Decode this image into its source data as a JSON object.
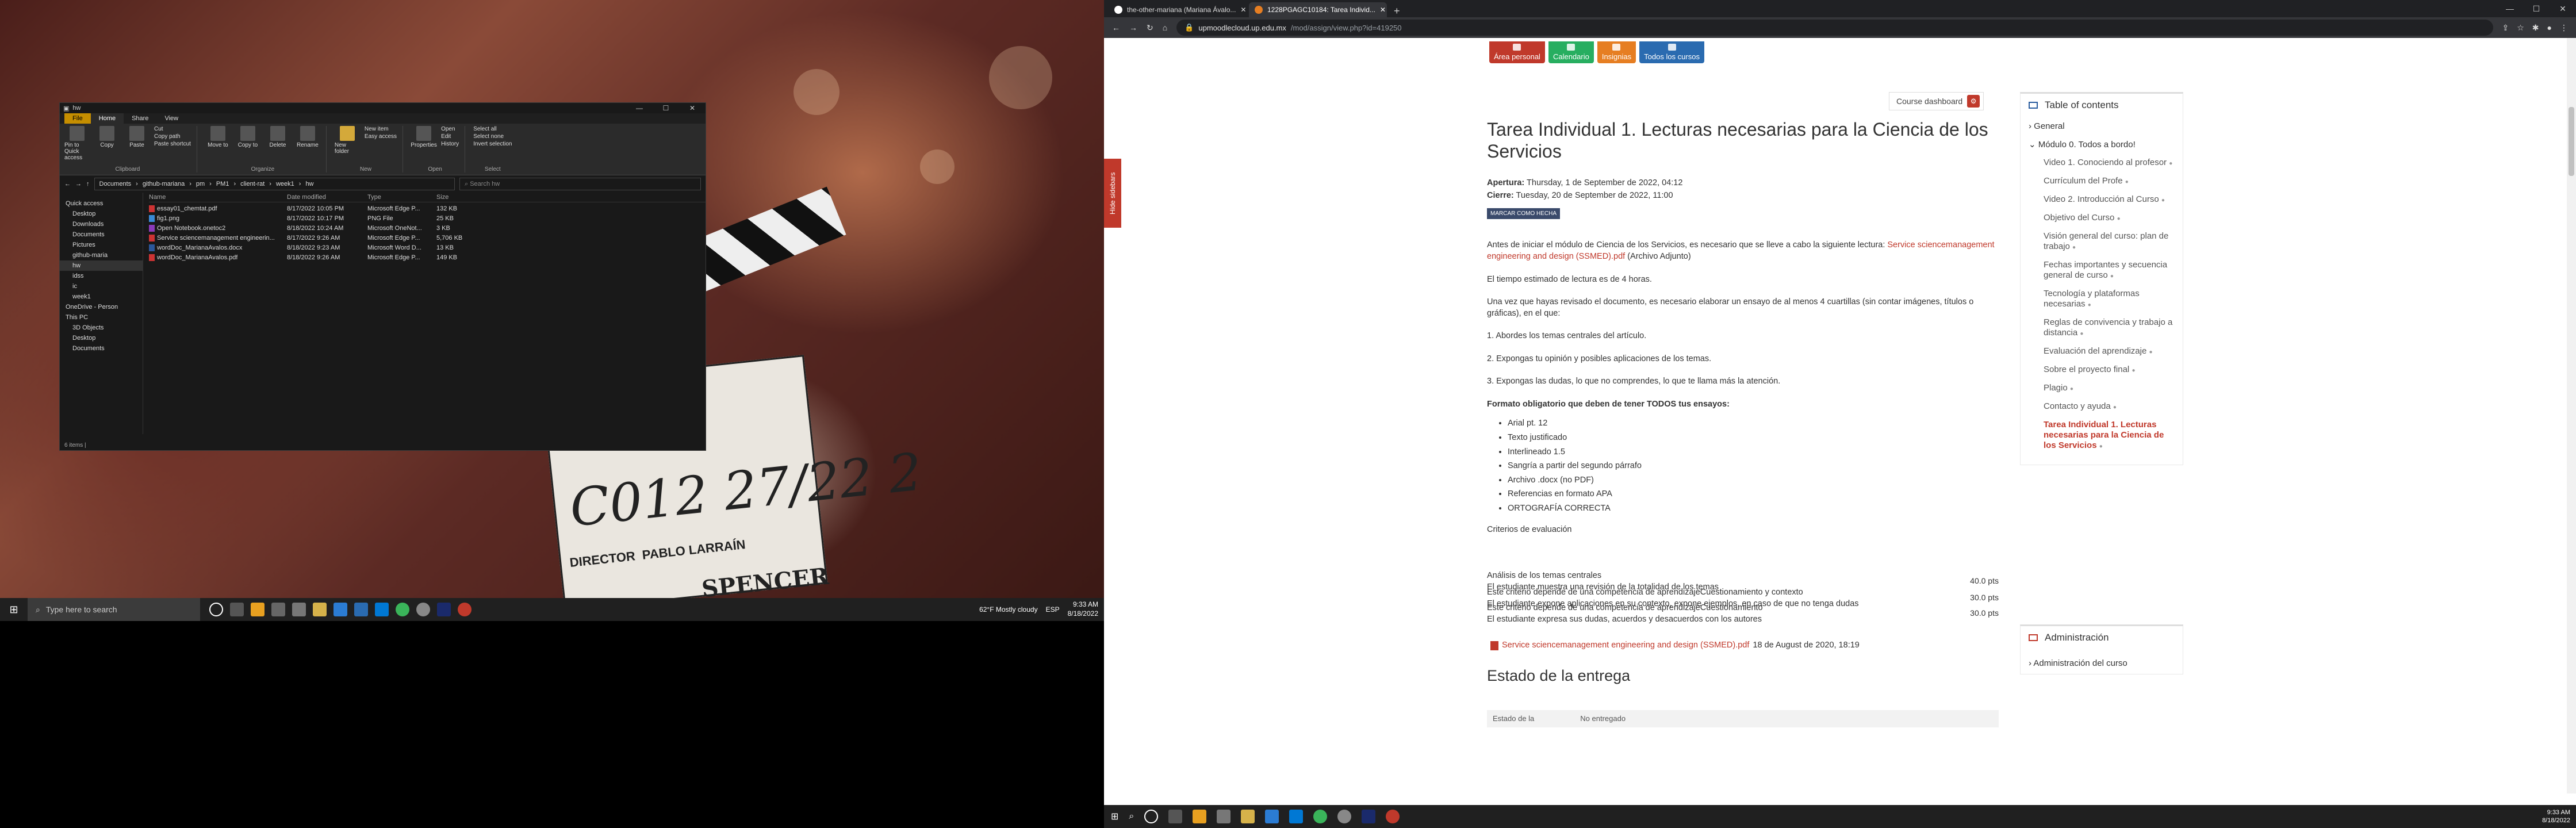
{
  "explorer": {
    "title": "hw",
    "tabs": [
      "File",
      "Home",
      "Share",
      "View"
    ],
    "ribbon": {
      "clipboard": {
        "label": "Clipboard",
        "pin": "Pin to Quick access",
        "copy": "Copy",
        "paste": "Paste",
        "cut": "Cut",
        "copy_path": "Copy path",
        "paste_shortcut": "Paste shortcut"
      },
      "organize": {
        "label": "Organize",
        "move_to": "Move to",
        "copy_to": "Copy to",
        "delete": "Delete",
        "rename": "Rename"
      },
      "new": {
        "label": "New",
        "new_folder": "New folder",
        "new_item": "New item",
        "easy_access": "Easy access"
      },
      "open": {
        "label": "Open",
        "properties": "Properties",
        "open": "Open",
        "edit": "Edit",
        "history": "History"
      },
      "select": {
        "label": "Select",
        "select_all": "Select all",
        "select_none": "Select none",
        "invert": "Invert selection"
      }
    },
    "path": [
      "Documents",
      "github-mariana",
      "pm",
      "PM1",
      "client-rat",
      "week1",
      "hw"
    ],
    "search_placeholder": "Search hw",
    "nav": [
      "Quick access",
      "Desktop",
      "Downloads",
      "Documents",
      "Pictures",
      "github-maria",
      "hw",
      "idss",
      "ic",
      "week1",
      "OneDrive - Person",
      "This PC",
      "3D Objects",
      "Desktop",
      "Documents"
    ],
    "columns": [
      "Name",
      "Date modified",
      "Type",
      "Size"
    ],
    "files": [
      {
        "name": "essay01_chemtat.pdf",
        "date": "8/17/2022 10:05 PM",
        "type": "Microsoft Edge P...",
        "size": "132 KB"
      },
      {
        "name": "fig1.png",
        "date": "8/17/2022 10:17 PM",
        "type": "PNG File",
        "size": "25 KB"
      },
      {
        "name": "Open Notebook.onetoc2",
        "date": "8/18/2022 10:24 AM",
        "type": "Microsoft OneNot...",
        "size": "3 KB"
      },
      {
        "name": "Service sciencemanagement engineerin...",
        "date": "8/17/2022 9:26 AM",
        "type": "Microsoft Edge P...",
        "size": "5,706 KB"
      },
      {
        "name": "wordDoc_MarianaAvalos.docx",
        "date": "8/18/2022 9:23 AM",
        "type": "Microsoft Word D...",
        "size": "13 KB"
      },
      {
        "name": "wordDoc_MarianaAvalos.pdf",
        "date": "8/18/2022 9:26 AM",
        "type": "Microsoft Edge P...",
        "size": "149 KB"
      }
    ],
    "status": "6 items  |"
  },
  "taskbar_left": {
    "search": "Type here to search",
    "weather": "62°F  Mostly cloudy",
    "lang": "ESP",
    "time": "9:33 AM",
    "date": "8/18/2022"
  },
  "browser": {
    "tabs": [
      {
        "title": "the-other-mariana (Mariana Ávalo..."
      },
      {
        "title": "1228PGAGC10184: Tarea Individ..."
      }
    ],
    "url_host": "upmoodlecloud.up.edu.mx",
    "url_path": "/mod/assign/view.php?id=419250"
  },
  "moodle": {
    "side_handle": "Hide sidebars",
    "topnav": [
      {
        "label": "Área personal",
        "color": "#c0392b"
      },
      {
        "label": "Calendario",
        "color": "#27ae60"
      },
      {
        "label": "Insignias",
        "color": "#e67e22"
      },
      {
        "label": "Todos los cursos",
        "color": "#2a6bb0"
      }
    ],
    "course_dashboard": "Course dashboard",
    "title": "Tarea Individual 1. Lecturas necesarias para la Ciencia de los Servicios",
    "opened_label": "Apertura:",
    "opened": "Thursday, 1 de September de 2022, 04:12",
    "due_label": "Cierre:",
    "due": "Tuesday, 20 de September de 2022, 11:00",
    "mark_done": "MARCAR COMO HECHA",
    "p1_a": "Antes de iniciar el módulo de Ciencia de los Servicios, es necesario que se lleve a cabo la siguiente lectura: ",
    "p1_link": "Service sciencemanagement engineering and design (SSMED).pdf",
    "p1_b": " (Archivo Adjunto)",
    "p2": "El tiempo estimado de lectura es de 4 horas.",
    "p3": "Una vez que hayas revisado el documento, es necesario elaborar un ensayo de al menos 4 cuartillas (sin contar imágenes, títulos o gráficas), en el que:",
    "p4": "1. Abordes los temas centrales del artículo.",
    "p5": "2. Expongas tu opinión y posibles aplicaciones de los temas.",
    "p6": "3. Expongas las dudas, lo que no comprendes, lo que te llama más la atención.",
    "format_h": "Formato obligatorio que deben de tener TODOS tus ensayos:",
    "format": [
      "Arial pt. 12",
      "Texto justificado",
      "Interlineado 1.5",
      "Sangría a partir del segundo párrafo",
      "Archivo .docx (no PDF)",
      "Referencias en formato APA",
      "ORTOGRAFÍA CORRECTA"
    ],
    "criteria_h": "Criterios de evaluación",
    "criteria": [
      {
        "l1": "Análisis de los temas centrales",
        "l2": "El estudiante muestra una revisión de la totalidad de los temas",
        "pts": "40.0 pts"
      },
      {
        "l1": "Este criterio depende de una competencia de aprendizajeCuestionamiento y contexto",
        "l2": "El estudiante expone aplicaciones en su contexto, expone ejemplos, en caso de que no tenga dudas",
        "pts": "30.0 pts"
      },
      {
        "l1": "Este criterio depende de una competencia de aprendizajeCuestionamiento",
        "l2": "El estudiante expresa sus dudas, acuerdos y desacuerdos con los autores",
        "pts": "30.0 pts"
      }
    ],
    "attachment": "Service sciencemanagement engineering and design (SSMED).pdf",
    "attachment_date": "18 de August de 2020, 18:19",
    "estado": "Estado de la entrega",
    "estado_row": [
      "Estado de la",
      "No entregado"
    ],
    "toc_title": "Table of contents",
    "toc_general": "General",
    "toc_module": "Módulo 0. Todos a bordo!",
    "toc_items": [
      "Video 1. Conociendo al profesor",
      "Currículum del Profe",
      "Video 2. Introducción al Curso",
      "Objetivo del Curso",
      "Visión general del curso: plan de trabajo",
      "Fechas importantes y secuencia general de curso",
      "Tecnología y plataformas necesarias",
      "Reglas de convivencia y trabajo a distancia",
      "Evaluación del aprendizaje",
      "Sobre el proyecto final",
      "Plagio",
      "Contacto y ayuda"
    ],
    "toc_current": "Tarea Individual 1. Lecturas necesarias para la Ciencia de los Servicios",
    "admin_title": "Administración",
    "admin_item": "Administración del curso"
  },
  "taskbar_right": {
    "time": "9:33 AM",
    "date": "8/18/2022"
  }
}
